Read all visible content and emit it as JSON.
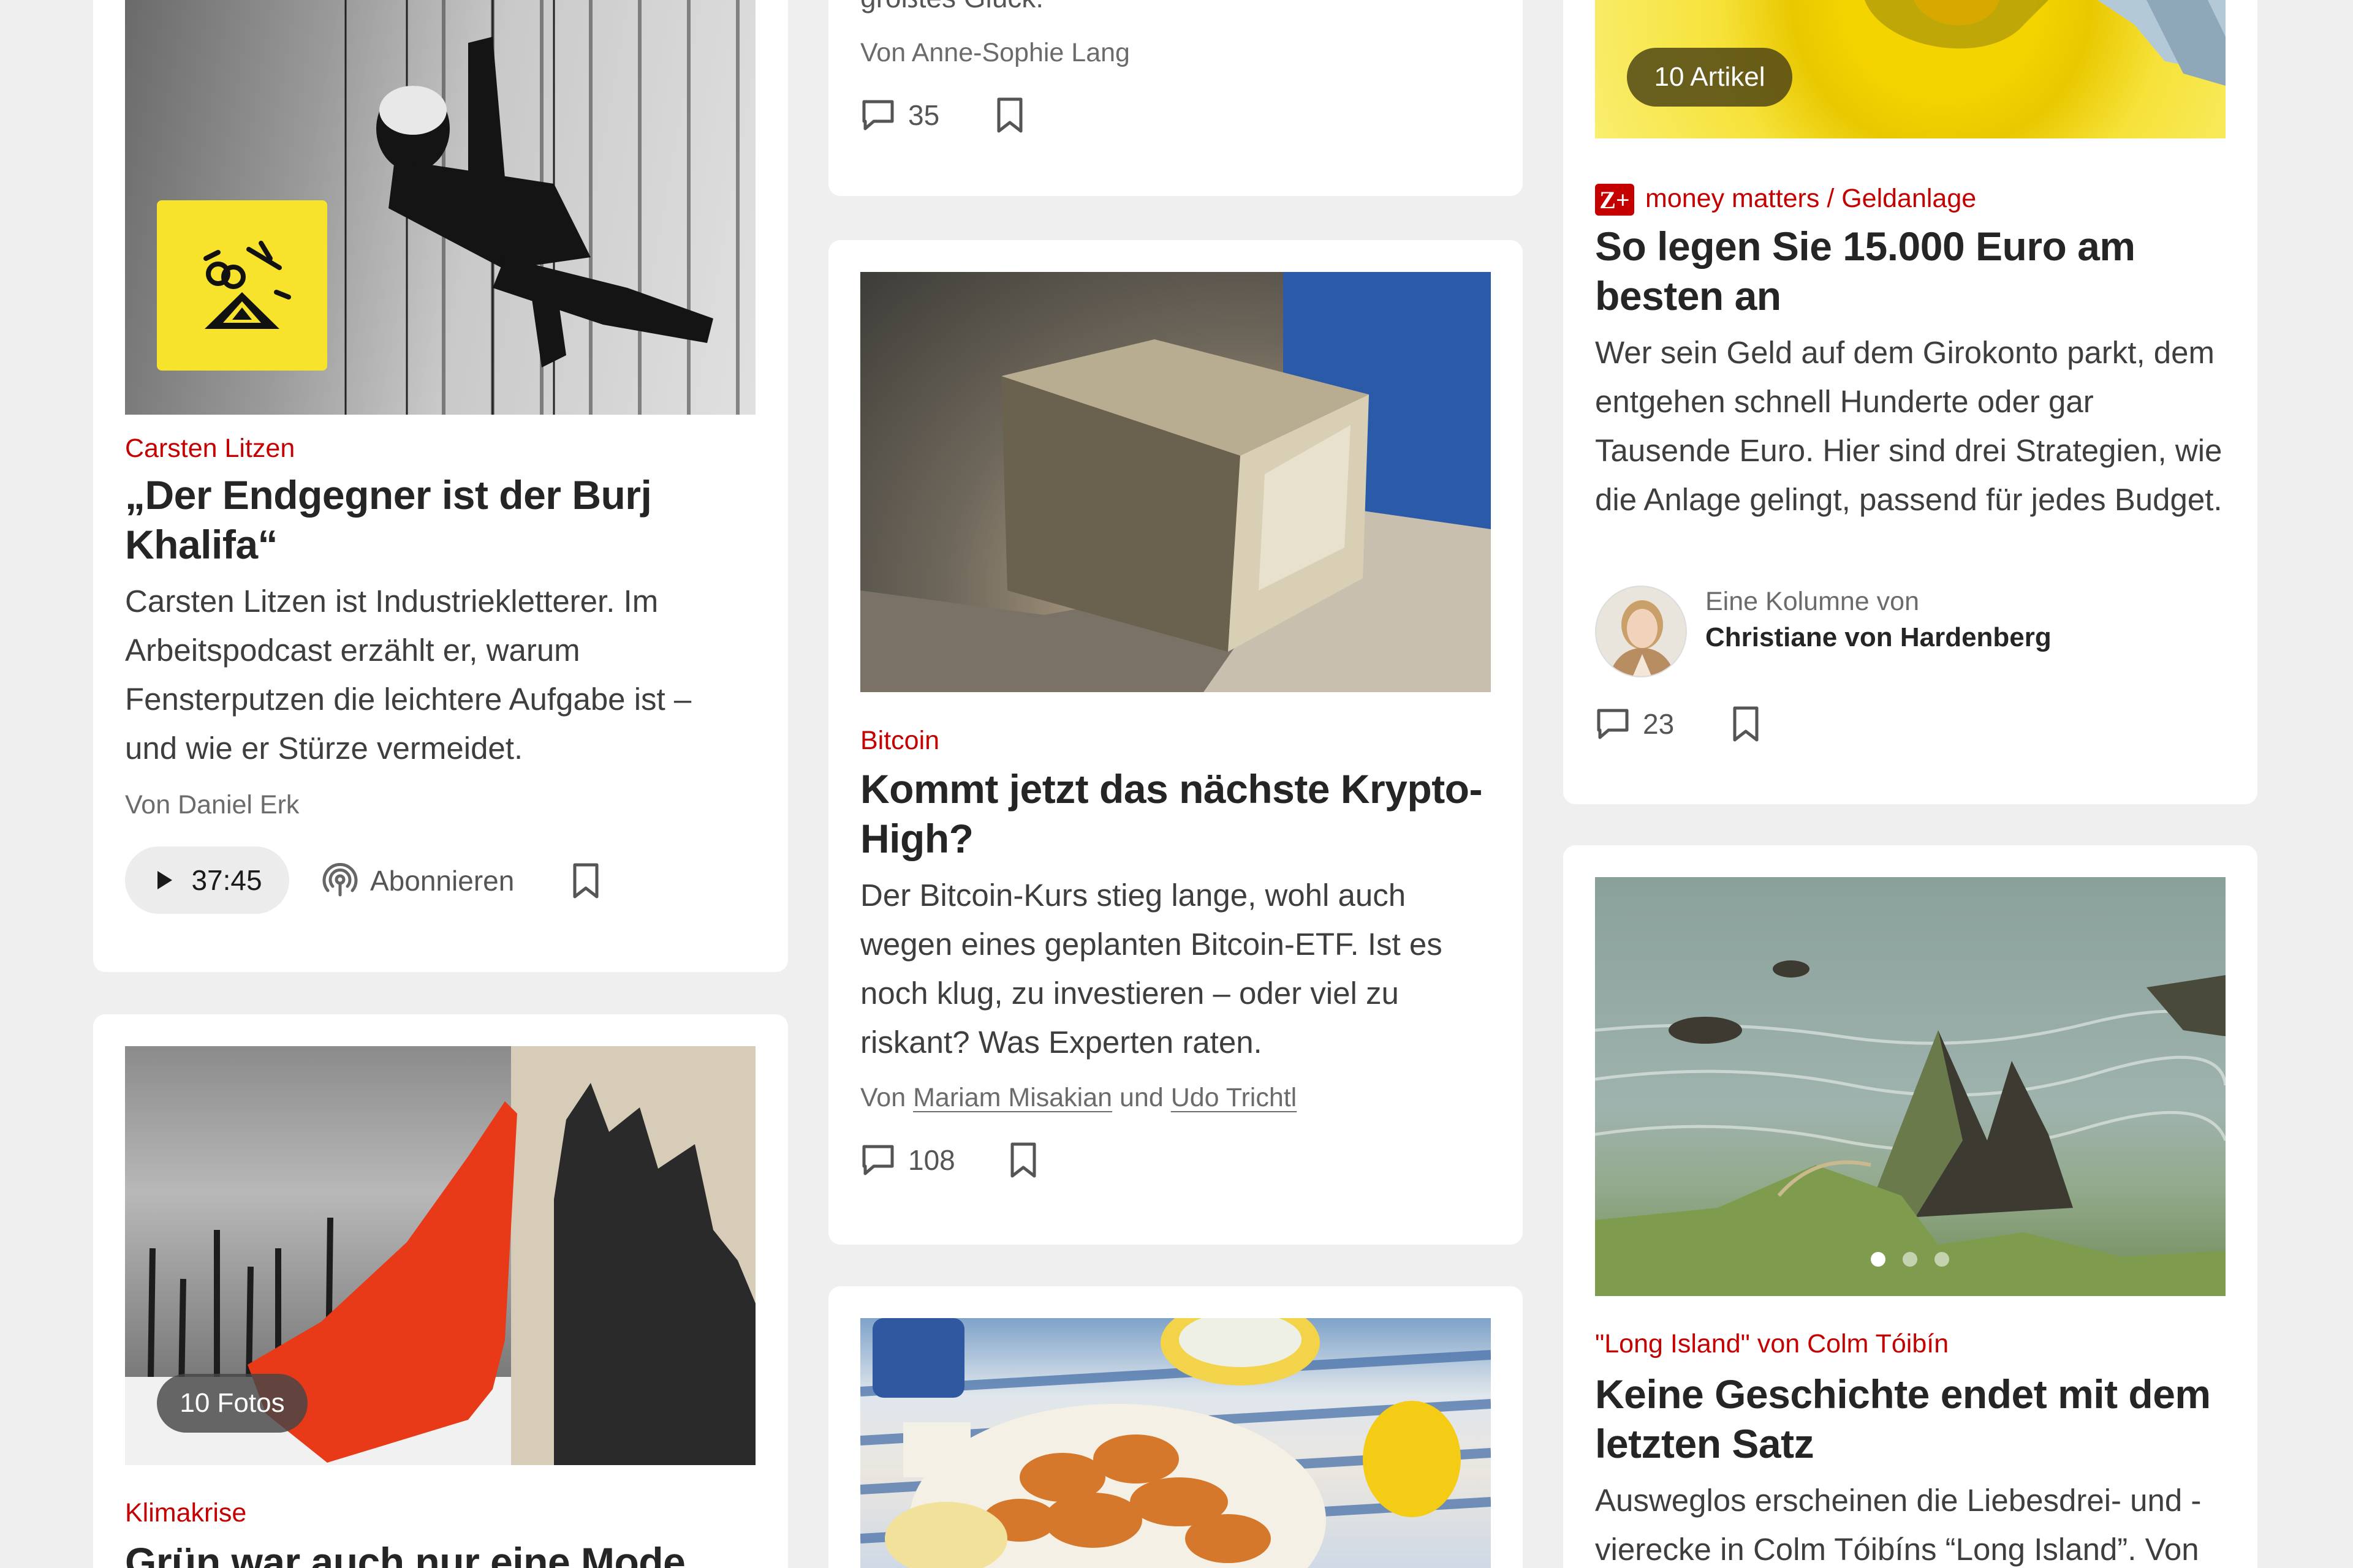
{
  "cards": {
    "podcast": {
      "kicker": "Carsten Litzen",
      "headline": "„Der Endgegner ist der Burj Khalifa“",
      "teaser": "Carsten Litzen ist Industriekletterer. Im Arbeitspodcast erzählt er, warum Fensterputzen die leichtere Aufgabe ist – und wie er Stürze vermeidet.",
      "byline": "Von Daniel Erk",
      "duration": "37:45",
      "subscribe": "Abonnieren"
    },
    "anne_sophie": {
      "cut_headline": "größtes Glück.",
      "byline": "Von Anne-Sophie Lang",
      "comments": "35"
    },
    "money": {
      "badge": "10 Artikel",
      "zplus": "Z+",
      "kicker": "money matters / Geldanlage",
      "headline": "So legen Sie 15.000 Euro am besten an",
      "teaser": "Wer sein Geld auf dem Girokonto parkt, dem entgehen schnell Hunderte oder gar Tausende Euro. Hier sind drei Strategien, wie die Anlage gelingt, passend für jedes Budget.",
      "column_label": "Eine Kolumne von",
      "column_author": "Christiane von Hardenberg",
      "comments": "23"
    },
    "bitcoin": {
      "kicker": "Bitcoin",
      "headline": "Kommt jetzt das nächste Krypto-High?",
      "teaser": "Der Bitcoin-Kurs stieg lange, wohl auch wegen eines geplanten Bitcoin-ETF. Ist es noch klug, zu investieren – oder viel zu riskant? Was Experten raten.",
      "byline_prefix": "Von",
      "author1": "Mariam Misakian",
      "byline_and": "und",
      "author2": "Udo Trichtl",
      "comments": "108"
    },
    "climate": {
      "badge": "10 Fotos",
      "kicker": "Klimakrise",
      "headline": "Grün war auch nur eine Mode"
    },
    "long_island": {
      "kicker": "\"Long Island\" von Colm Tóibín",
      "headline": "Keine Geschichte endet mit dem letzten Satz",
      "teaser": "Ausweglos erscheinen die Liebesdrei- und -vierecke in Colm Tóibíns “Long Island”. Von",
      "carousel_active": 1,
      "carousel_total": 3
    }
  },
  "colors": {
    "accent": "#c50000",
    "background": "#efefef",
    "card": "#ffffff",
    "text": "#252525"
  },
  "icons": [
    "play-icon",
    "podcast-icon",
    "bookmark-icon",
    "comment-icon",
    "avatar"
  ]
}
